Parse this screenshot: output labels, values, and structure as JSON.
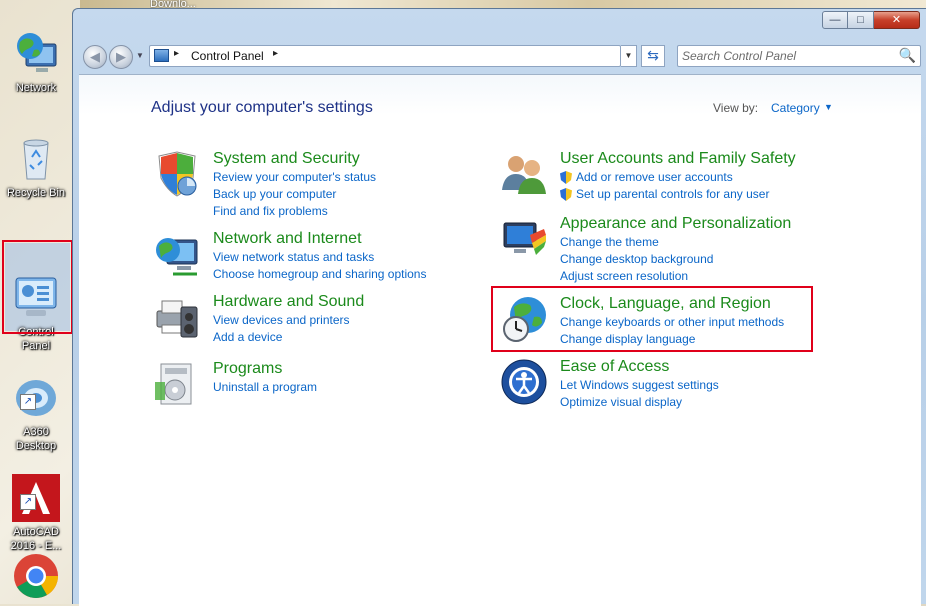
{
  "desktop": {
    "top_window_stub": "Downlo...",
    "icons": [
      {
        "label": "Network",
        "icon": "network-globe-icon"
      },
      {
        "label": "Recycle Bin",
        "icon": "recycle-bin-icon"
      },
      {
        "label": "Control\nPanel",
        "icon": "control-panel-icon",
        "selected": true
      },
      {
        "label": "A360\nDesktop",
        "icon": "a360-desktop-icon",
        "shortcut": true
      },
      {
        "label": "AutoCAD\n2016 - E...",
        "icon": "autocad-icon",
        "shortcut": true
      },
      {
        "label": "",
        "icon": "chrome-icon"
      }
    ]
  },
  "window": {
    "caption": {
      "minimize": "—",
      "maximize": "□",
      "close": "✕"
    },
    "nav": {
      "back": "◀",
      "forward": "▶",
      "breadcrumb_sep_1": "▸",
      "breadcrumb": "Control Panel",
      "breadcrumb_sep_2": "▸",
      "dropdown": "▼",
      "refresh": "⇆",
      "search_placeholder": "Search Control Panel",
      "search_icon": "🔍"
    },
    "content": {
      "heading": "Adjust your computer's settings",
      "view_by_label": "View by:",
      "view_by_value": "Category",
      "view_by_arrow": "▼",
      "left_column": [
        {
          "title": "System and Security",
          "icon": "shield-security-icon",
          "links": [
            "Review your computer's status",
            "Back up your computer",
            "Find and fix problems"
          ]
        },
        {
          "title": "Network and Internet",
          "icon": "network-internet-icon",
          "links": [
            "View network status and tasks",
            "Choose homegroup and sharing options"
          ]
        },
        {
          "title": "Hardware and Sound",
          "icon": "hardware-sound-icon",
          "links": [
            "View devices and printers",
            "Add a device"
          ]
        },
        {
          "title": "Programs",
          "icon": "programs-icon",
          "links": [
            "Uninstall a program"
          ]
        }
      ],
      "right_column": [
        {
          "title": "User Accounts and Family Safety",
          "icon": "user-accounts-icon",
          "links": [
            "Add or remove user accounts",
            "Set up parental controls for any user"
          ]
        },
        {
          "title": "Appearance and Personalization",
          "icon": "appearance-icon",
          "links": [
            "Change the theme",
            "Change desktop background",
            "Adjust screen resolution"
          ]
        },
        {
          "title": "Clock, Language, and Region",
          "icon": "clock-globe-icon",
          "links": [
            "Change keyboards or other input methods",
            "Change display language"
          ],
          "highlighted": true
        },
        {
          "title": "Ease of Access",
          "icon": "ease-of-access-icon",
          "links": [
            "Let Windows suggest settings",
            "Optimize visual display"
          ]
        }
      ]
    }
  },
  "colors": {
    "category_title": "#1b8a1b",
    "link": "#0b66c8",
    "heading": "#1e3287",
    "highlight": "#e0001a"
  }
}
